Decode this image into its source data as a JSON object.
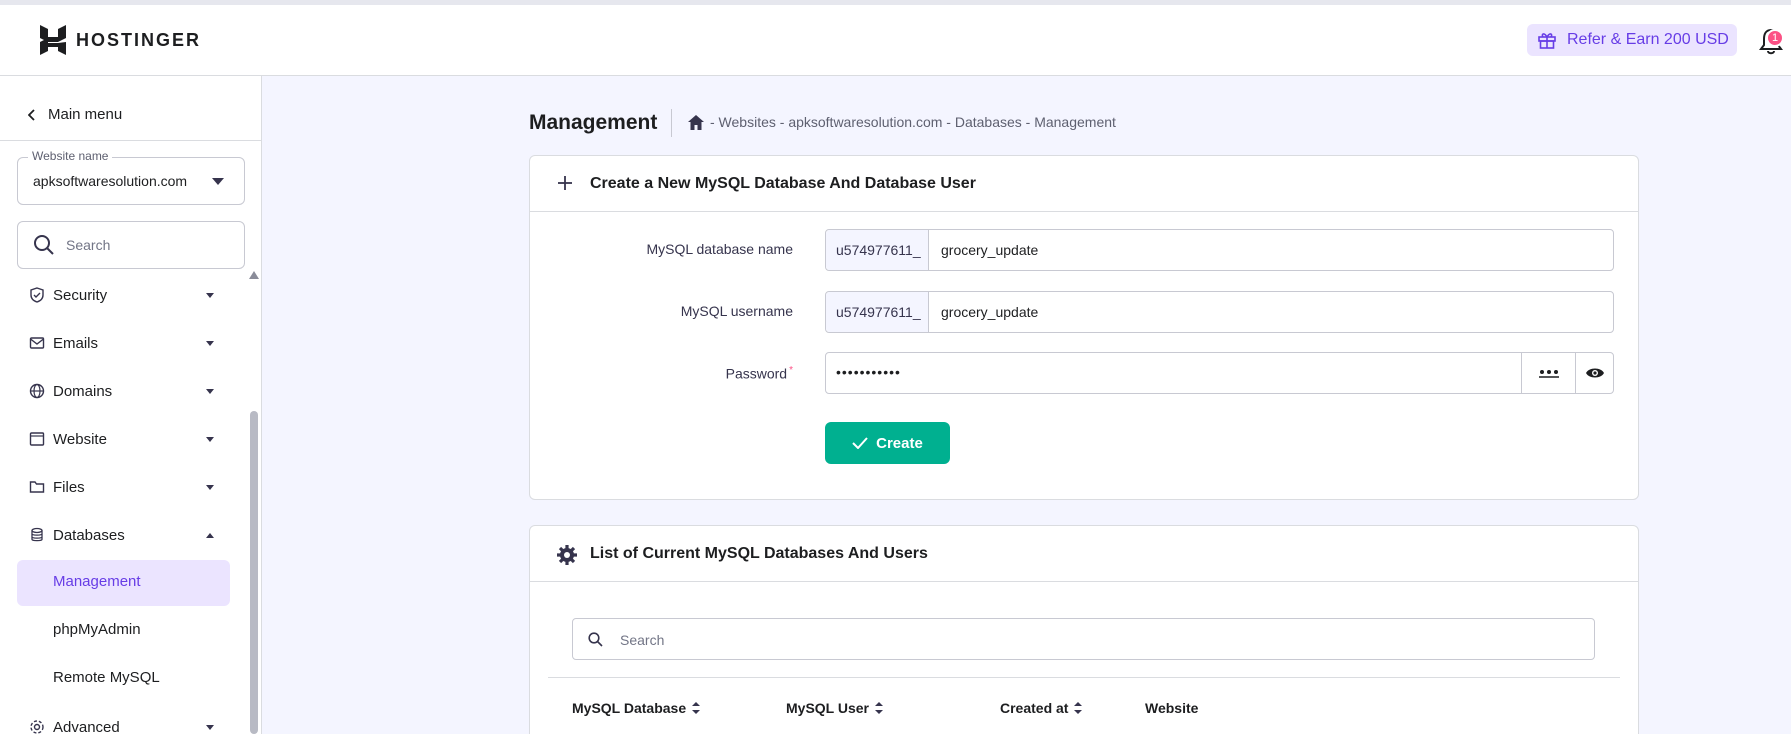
{
  "header": {
    "brand": "HOSTINGER",
    "refer_label": "Refer & Earn 200 USD",
    "notification_count": "1"
  },
  "sidebar": {
    "main_menu": "Main menu",
    "website_label": "Website name",
    "website_value": "apksoftwaresolution.com",
    "search_placeholder": "Search",
    "items": [
      {
        "label": "Security",
        "icon": "shield-icon"
      },
      {
        "label": "Emails",
        "icon": "mail-icon"
      },
      {
        "label": "Domains",
        "icon": "globe-icon"
      },
      {
        "label": "Website",
        "icon": "browser-icon"
      },
      {
        "label": "Files",
        "icon": "folder-icon"
      },
      {
        "label": "Databases",
        "icon": "database-icon"
      }
    ],
    "sub_items": [
      "Management",
      "phpMyAdmin",
      "Remote MySQL"
    ],
    "advanced": "Advanced"
  },
  "page": {
    "title": "Management",
    "breadcrumb": "- Websites - apksoftwaresolution.com - Databases - Management"
  },
  "create_card": {
    "title": "Create a New MySQL Database And Database User",
    "db_name_label": "MySQL database name",
    "db_prefix": "u574977611_",
    "db_name_value": "grocery_update",
    "username_label": "MySQL username",
    "user_prefix": "u574977611_",
    "username_value": "grocery_update",
    "password_label": "Password",
    "password_required": "*",
    "password_value": "•••••••••••",
    "create_label": "Create"
  },
  "list_card": {
    "title": "List of Current MySQL Databases And Users",
    "search_placeholder": "Search",
    "columns": [
      "MySQL Database",
      "MySQL User",
      "Created at",
      "Website"
    ]
  },
  "colors": {
    "accent": "#673de6",
    "accent_bg": "#ebe4ff",
    "success": "#00b090",
    "background": "#f4f5ff"
  }
}
